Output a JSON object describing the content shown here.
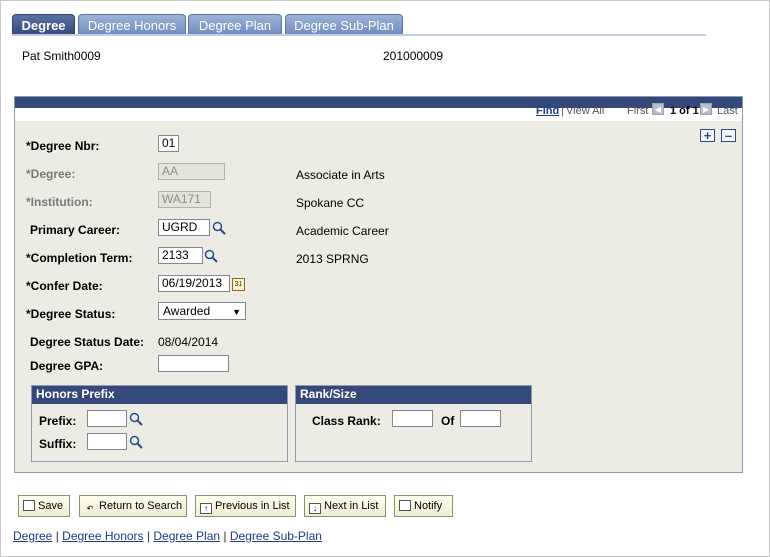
{
  "tabs": [
    {
      "label": "Degree"
    },
    {
      "label": "Degree Honors"
    },
    {
      "label": "Degree Plan"
    },
    {
      "label": "Degree Sub-Plan"
    }
  ],
  "header": {
    "student_name": "Pat Smith0009",
    "student_id": "201000009"
  },
  "nav": {
    "find": "Find",
    "separator": "|",
    "view_all": "View All",
    "first": "First",
    "page": "1 of 1",
    "last": "Last"
  },
  "form": {
    "degree_nbr": {
      "label": "*Degree Nbr:",
      "value": "01"
    },
    "degree": {
      "label": "*Degree:",
      "value": "AA",
      "description": "Associate in Arts"
    },
    "institution": {
      "label": "*Institution:",
      "value": "WA171",
      "description": "Spokane CC"
    },
    "primary_career": {
      "label": "Primary Career:",
      "value": "UGRD",
      "description": "Academic Career"
    },
    "completion_term": {
      "label": "*Completion Term:",
      "value": "2133",
      "description": "2013 SPRNG"
    },
    "confer_date": {
      "label": "*Confer Date:",
      "value": "06/19/2013",
      "cal_text": "31"
    },
    "degree_status": {
      "label": "*Degree Status:",
      "value": "Awarded"
    },
    "degree_status_date": {
      "label": "Degree Status Date:",
      "value": "08/04/2014"
    },
    "degree_gpa": {
      "label": "Degree GPA:",
      "value": ""
    }
  },
  "honors_prefix": {
    "title": "Honors Prefix",
    "prefix_label": "Prefix:",
    "suffix_label": "Suffix:",
    "prefix_value": "",
    "suffix_value": ""
  },
  "rank_size": {
    "title": "Rank/Size",
    "class_rank_label": "Class Rank:",
    "of_label": "Of",
    "class_rank_value": "",
    "of_value": ""
  },
  "toolbar": {
    "save": "Save",
    "return_to_search": "Return to Search",
    "previous_in_list": "Previous in List",
    "next_in_list": "Next in List",
    "notify": "Notify"
  },
  "footer_links": [
    "Degree",
    "Degree Honors",
    "Degree Plan",
    "Degree Sub-Plan"
  ],
  "footer_separator": "|",
  "colors": {
    "header_band": "#34497a",
    "panel_bg": "#ecece4",
    "link": "#1f3a8a"
  }
}
